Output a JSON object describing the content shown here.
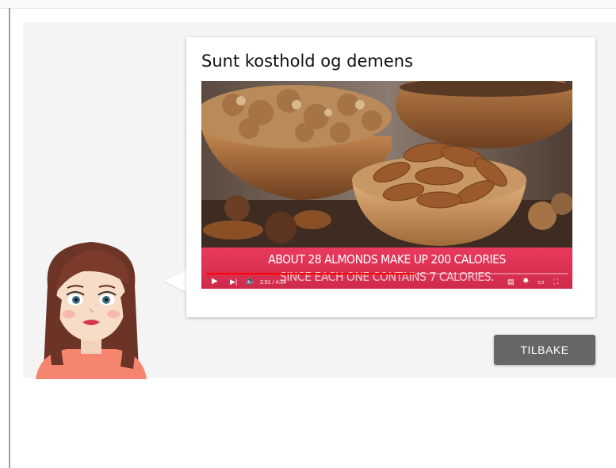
{
  "card": {
    "title": "Sunt kosthold og demens"
  },
  "video": {
    "caption_line1": "ABOUT 28 ALMONDS MAKE UP 200 CALORIES",
    "caption_line2": "SINCE EACH ONE CONTAINS 7 CALORIES.",
    "time": "2:51 / 4:54",
    "progress": 0.58,
    "icons": [
      "play-icon",
      "next-icon",
      "volume-icon",
      "subtitles-icon",
      "settings-icon",
      "theater-icon",
      "fullscreen-icon"
    ]
  },
  "buttons": {
    "back_label": "TILBAKE"
  },
  "colors": {
    "stage_bg": "#f4f4f4",
    "caption_bar": "#e02f52",
    "back_button": "#666666"
  }
}
